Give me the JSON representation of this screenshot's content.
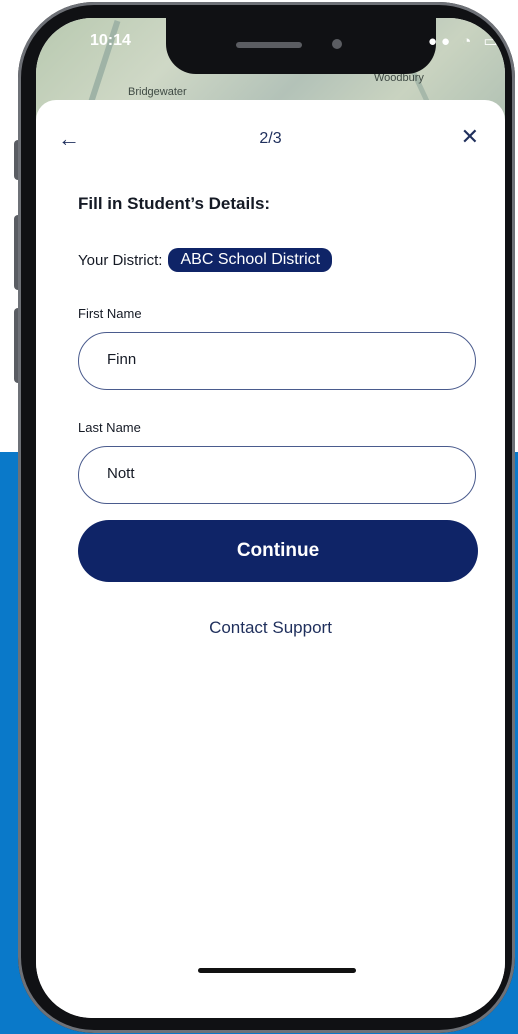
{
  "status_bar": {
    "time": "10:14",
    "icons": "●● ◔ ▭"
  },
  "map": {
    "label_left": "Bridgewater",
    "label_right": "Woodbury"
  },
  "nav": {
    "back_icon": "←",
    "step": "2/3",
    "close_icon": "✕"
  },
  "form": {
    "heading": "Fill in Student’s Details:",
    "district_label": "Your District:",
    "district_value": "ABC School District",
    "first_name_label": "First Name",
    "first_name_value": "Finn",
    "last_name_label": "Last Name",
    "last_name_value": "Nott"
  },
  "actions": {
    "continue_label": "Continue",
    "support_label": "Contact Support"
  },
  "colors": {
    "accent": "#0f2467",
    "background_blue": "#0a79c9",
    "text_dark": "#151a25"
  }
}
